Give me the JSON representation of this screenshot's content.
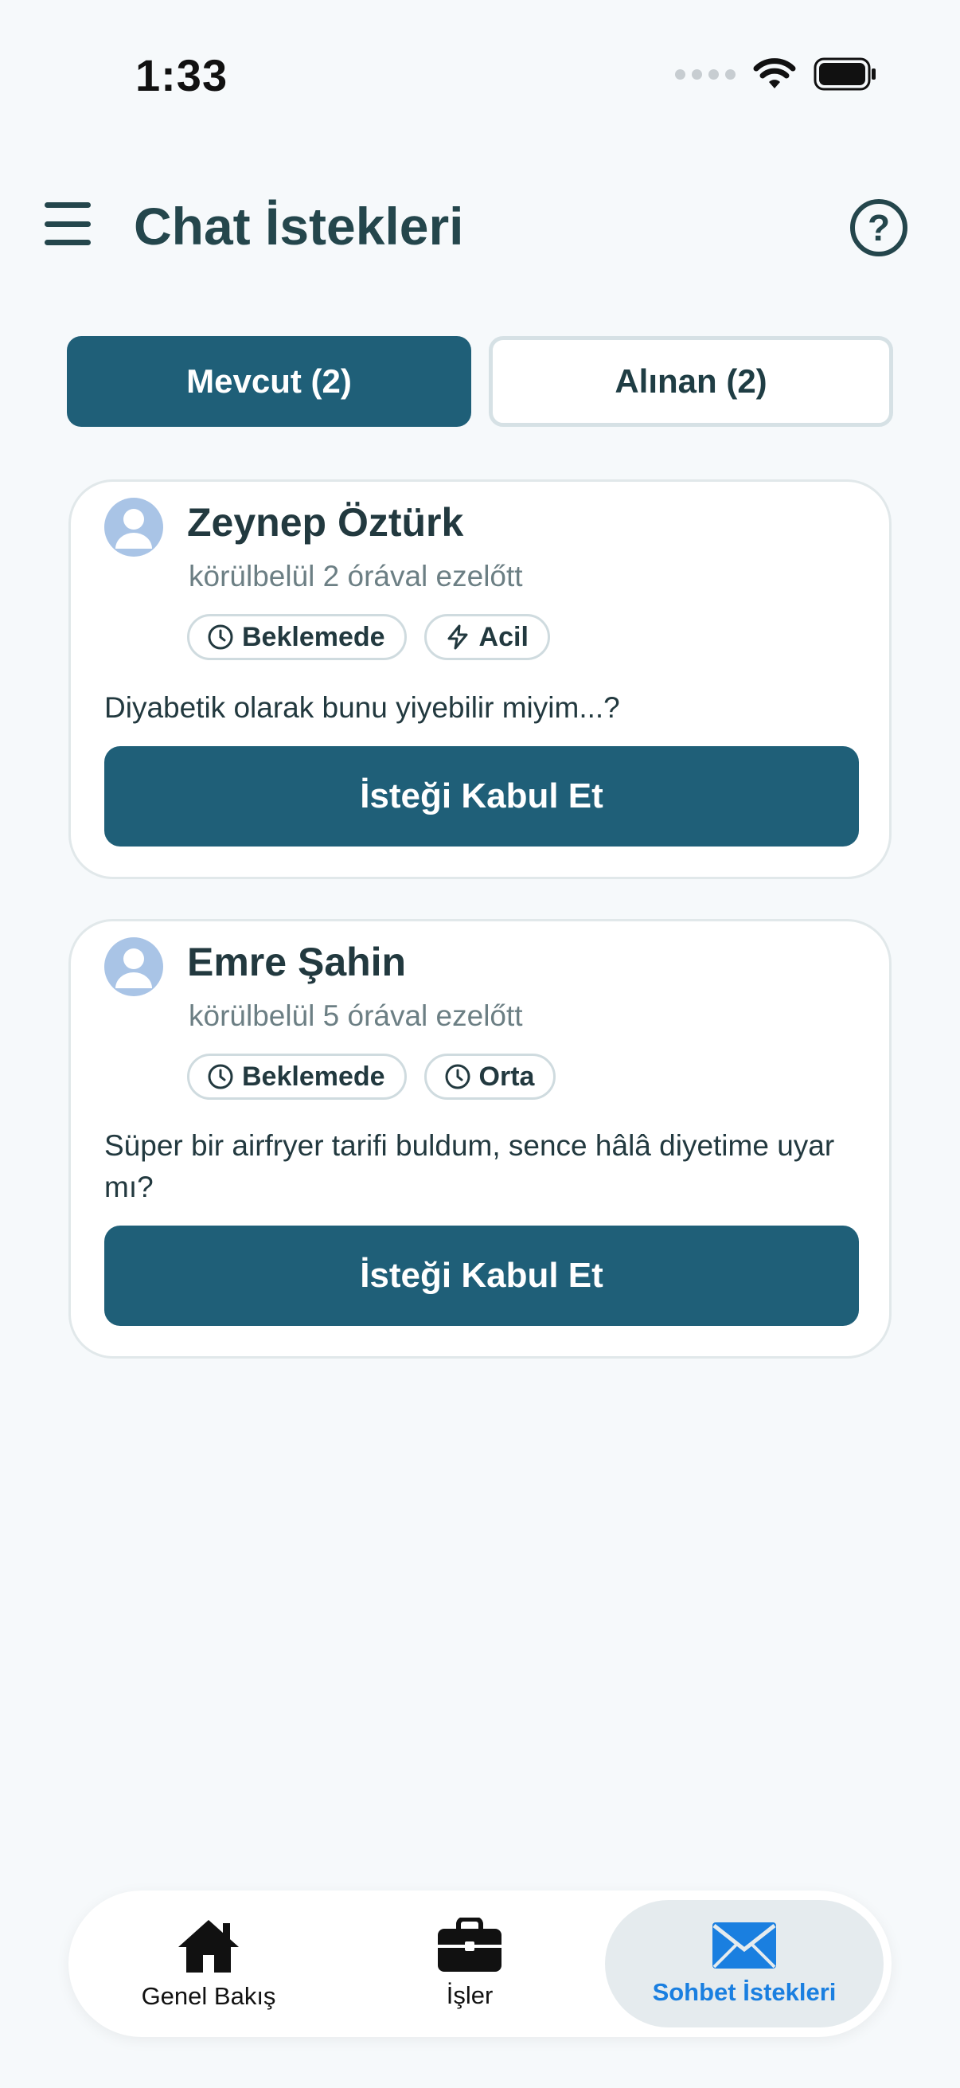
{
  "status_bar": {
    "time": "1:33"
  },
  "header": {
    "title": "Chat İstekleri",
    "help_symbol": "?"
  },
  "tabs": [
    {
      "label": "Mevcut (2)",
      "active": true
    },
    {
      "label": "Alınan (2)",
      "active": false
    }
  ],
  "requests": [
    {
      "name": "Zeynep Öztürk",
      "time_ago": "körülbelül 2 órával ezelőtt",
      "status": "Beklemede",
      "priority": "Acil",
      "priority_icon": "bolt-icon",
      "message": "Diyabetik olarak bunu yiyebilir miyim...?",
      "accept_label": "İsteği Kabul Et"
    },
    {
      "name": "Emre Şahin",
      "time_ago": "körülbelül 5 órával ezelőtt",
      "status": "Beklemede",
      "priority": "Orta",
      "priority_icon": "clock-icon",
      "message": "Süper bir airfryer tarifi buldum, sence hâlâ diyetime uyar mı?",
      "accept_label": "İsteği Kabul Et"
    }
  ],
  "bottom_nav": [
    {
      "label": "Genel Bakış",
      "icon": "home-icon",
      "active": false
    },
    {
      "label": "İşler",
      "icon": "briefcase-icon",
      "active": false
    },
    {
      "label": "Sohbet İstekleri",
      "icon": "envelope-icon",
      "active": true
    }
  ],
  "colors": {
    "primary": "#1f5f78",
    "background": "#f6f9fb",
    "active_nav_text": "#1a7fe0",
    "avatar": "#a9c4e6"
  }
}
